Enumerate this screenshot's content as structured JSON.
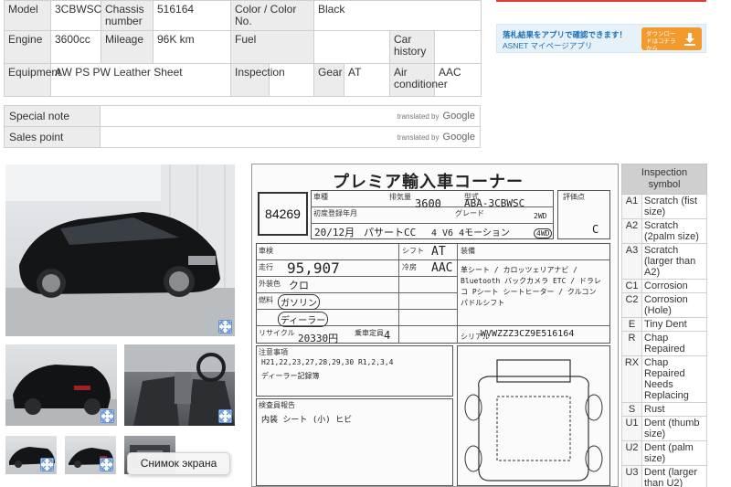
{
  "spec": {
    "row1": {
      "model_key": "Model",
      "model_val": "3CBWSC",
      "chassis_key": "Chassis number",
      "chassis_val": "516164",
      "color_key": "Color / Color No.",
      "color_val": "Black"
    },
    "row2": {
      "engine_key": "Engine",
      "engine_val": "3600cc",
      "mileage_key": "Mileage",
      "mileage_val": "96K km",
      "fuel_key": "Fuel",
      "fuel_val": "",
      "history_key": "Car history",
      "history_val": ""
    },
    "row3": {
      "equip_key": "Equipment",
      "equip_val": "AW PS PW Leather Sheet",
      "insp_key": "Inspection",
      "insp_val": "",
      "gear_key": "Gear",
      "gear_val": "AT",
      "aircon_key": "Air conditioner",
      "aircon_val": "AAC"
    }
  },
  "notes": [
    {
      "label": "Special note",
      "translated_by": "translated by",
      "google": "Google"
    },
    {
      "label": "Sales point",
      "translated_by": "translated by",
      "google": "Google"
    }
  ],
  "banner": {
    "line1": "落札結果をアプリで確認できます！",
    "line2": "ASNET マイページアプリ",
    "download": "ダウンロードはコチラから"
  },
  "tooltip": "Снимок экрана",
  "sheet": {
    "title": "プレミア輸入車コーナー",
    "lot_number": "84269",
    "labels": {
      "name": "車種",
      "displacement": "排気量",
      "model_type": "型式",
      "first_reg": "初度登録年月",
      "grade": "グレード",
      "score": "評価点",
      "shaken": "車検",
      "shift": "シフト",
      "mileage": "走行",
      "aircon": "冷房",
      "outer_color": "外装色",
      "fuel": "燃料",
      "equipment": "装備",
      "recycle": "リサイクル",
      "capacity": "乗車定員",
      "vin": "シリアル",
      "notes": "注意事項",
      "inspector": "検査員報告"
    },
    "handwritten": {
      "displacement": "3600",
      "model_type": "ABA-3CBWSC",
      "year": "20/12月",
      "name": "パサートCC",
      "grade": "4 V6 4モーション",
      "drive": "4WD",
      "door": "2WD",
      "score": "C",
      "mileage": "95,907",
      "shift": "AT",
      "aircon": "AAC",
      "color": "クロ",
      "fuel": "ガソリン",
      "dealer": "ディーラー",
      "recycle": "20330円",
      "capacity": "4",
      "vin": "WVWZZZ3CZ9E516164",
      "history_notes": "H21,22,23,27,28,29,30 R1,2,3,4",
      "dealer_record": "ディーラー記録簿",
      "sales_points": "革シート / カロッツェリアナビ / Bluetooth バックカメラ ETC / ドラレコ Pシート シートヒーター / クルコン パドルシフト",
      "inspector_notes": "内装 シート (小) ヒビ"
    }
  },
  "symbols": {
    "header": "Inspection symbol",
    "items": [
      {
        "code": "A1",
        "desc": "Scratch (fist size)"
      },
      {
        "code": "A2",
        "desc": "Scratch (2palm size)"
      },
      {
        "code": "A3",
        "desc": "Scratch (larger than A2)"
      },
      {
        "code": "C1",
        "desc": "Corrosion"
      },
      {
        "code": "C2",
        "desc": "Corrosion (Hole)"
      },
      {
        "code": "E",
        "desc": "Tiny Dent"
      },
      {
        "code": "R",
        "desc": "Chap Repaired"
      },
      {
        "code": "RX",
        "desc": "Chap Repaired Needs Replacing"
      },
      {
        "code": "S",
        "desc": "Rust"
      },
      {
        "code": "U1",
        "desc": "Dent (thumb size)"
      },
      {
        "code": "U2",
        "desc": "Dent (palm size)"
      },
      {
        "code": "U3",
        "desc": "Dent (larger than U2)"
      }
    ]
  },
  "colors": {
    "accent_red": "#e03c31",
    "banner_blue": "#1a6fb4",
    "download_orange": "#f29b2c",
    "expand_blue": "#5b8fd6"
  },
  "icons": {
    "expand": "expand-icon",
    "download": "download-icon"
  }
}
